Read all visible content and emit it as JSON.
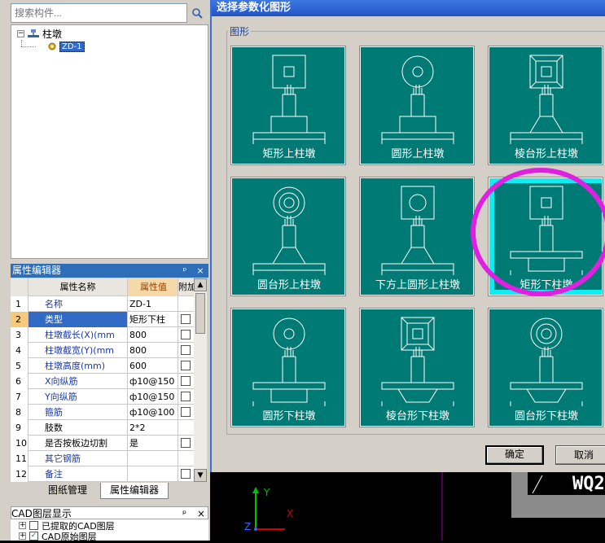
{
  "search": {
    "placeholder": "搜索构件..."
  },
  "tree": {
    "root_label": "柱墩",
    "child_label": "ZD-1"
  },
  "property_editor": {
    "title": "属性编辑器",
    "headers": {
      "name": "属性名称",
      "value": "属性值",
      "extra": "附加"
    },
    "rows": [
      {
        "num": "1",
        "name": "名称",
        "value": "ZD-1",
        "checkbox": false
      },
      {
        "num": "2",
        "name": "类型",
        "value": "矩形下柱",
        "checkbox": true
      },
      {
        "num": "3",
        "name": "柱墩截长(X)(mm",
        "value": "800",
        "checkbox": true
      },
      {
        "num": "4",
        "name": "柱墩截宽(Y)(mm",
        "value": "800",
        "checkbox": true
      },
      {
        "num": "5",
        "name": "柱墩高度(mm)",
        "value": "600",
        "checkbox": true
      },
      {
        "num": "6",
        "name": "X向纵筋",
        "value": "ф10@150",
        "checkbox": true
      },
      {
        "num": "7",
        "name": "Y向纵筋",
        "value": "ф10@150",
        "checkbox": true
      },
      {
        "num": "8",
        "name": "箍筋",
        "value": "ф10@100",
        "checkbox": true
      },
      {
        "num": "9",
        "name": "肢数",
        "value": "2*2",
        "checkbox": false
      },
      {
        "num": "10",
        "name": "是否按板边切割",
        "value": "是",
        "checkbox": true
      },
      {
        "num": "11",
        "name": "其它钢筋",
        "value": "",
        "checkbox": false
      },
      {
        "num": "12",
        "name": "备注",
        "value": "",
        "checkbox": true
      }
    ]
  },
  "bottom_tabs": {
    "tab1": "图纸管理",
    "tab2": "属性编辑器"
  },
  "cad_panel": {
    "title": "CAD图层显示",
    "items": [
      {
        "label": "已提取的CAD图层",
        "checked": false
      },
      {
        "label": "CAD原始图层",
        "checked": true
      }
    ]
  },
  "dialog": {
    "title": "选择参数化图形",
    "group_label": "图形",
    "shapes": [
      {
        "label": "矩形上柱墩",
        "icon": "rect-upper-pier-icon"
      },
      {
        "label": "圆形上柱墩",
        "icon": "round-upper-pier-icon"
      },
      {
        "label": "棱台形上柱墩",
        "icon": "frustum-upper-pier-icon"
      },
      {
        "label": "圆台形上柱墩",
        "icon": "cone-upper-pier-icon"
      },
      {
        "label": "下方上圆形上柱墩",
        "icon": "square-bottom-round-top-pier-icon"
      },
      {
        "label": "矩形下柱墩",
        "icon": "rect-lower-pier-icon",
        "selected": true
      },
      {
        "label": "圆形下柱墩",
        "icon": "round-lower-pier-icon"
      },
      {
        "label": "棱台形下柱墩",
        "icon": "frustum-lower-pier-icon"
      },
      {
        "label": "圆台形下柱墩",
        "icon": "cone-lower-pier-icon"
      }
    ],
    "ok_label": "确定",
    "cancel_label": "取消"
  },
  "canvas": {
    "text": "WQ2",
    "axis_y": "Y",
    "axis_x": "X",
    "axis_z": "Z"
  },
  "colors": {
    "tile": "#007a74",
    "selected": "#0eeef0",
    "highlight_circle": "#e020e0"
  }
}
